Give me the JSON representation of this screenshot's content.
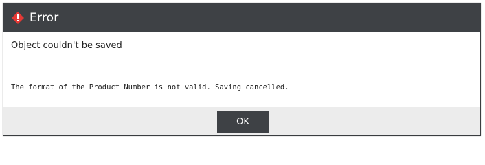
{
  "dialog": {
    "title": "Error",
    "heading": "Object couldn't be saved",
    "message": "The format of the Product Number is not valid. Saving cancelled.",
    "ok_label": "OK"
  },
  "icons": {
    "title_icon": "error-diamond-icon"
  },
  "colors": {
    "titlebar": "#3e4145",
    "error_icon": "#e53935",
    "button": "#3e4145",
    "footer": "#ececec"
  }
}
